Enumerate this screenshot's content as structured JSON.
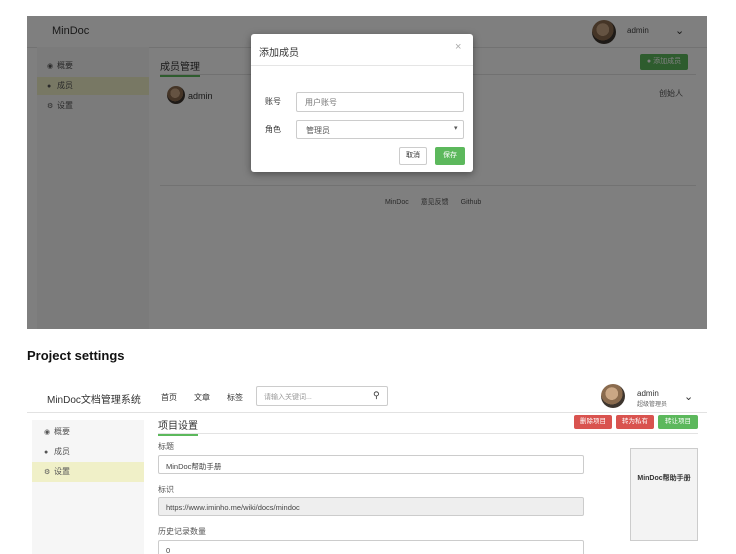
{
  "modal_screen": {
    "app_logo": "MinDoc",
    "user": {
      "name": "admin"
    },
    "sidebar": {
      "items": [
        {
          "icon": "dashboard-icon",
          "label": "概要"
        },
        {
          "icon": "users-icon",
          "label": "成员"
        },
        {
          "icon": "gear-icon",
          "label": "设置"
        }
      ]
    },
    "page_title": "成员管理",
    "add_member_button": "添加成员",
    "member": {
      "name": "admin",
      "role": "创始人"
    },
    "footer_links": [
      "MinDoc",
      "意见反馈",
      "Github"
    ],
    "dialog": {
      "title": "添加成员",
      "close": "×",
      "account_label": "账号",
      "account_placeholder": "用户账号",
      "role_label": "角色",
      "role_value": "管理员",
      "cancel_label": "取消",
      "save_label": "保存"
    }
  },
  "caption": "Project settings",
  "settings_screen": {
    "app_logo": "MinDoc文档管理系统",
    "nav": [
      "首页",
      "文章",
      "标签"
    ],
    "search_placeholder": "请输入关键词...",
    "user": {
      "name": "admin",
      "role": "超级管理员"
    },
    "sidebar": {
      "items": [
        {
          "icon": "dashboard-icon",
          "label": "概要"
        },
        {
          "icon": "users-icon",
          "label": "成员"
        },
        {
          "icon": "gear-icon",
          "label": "设置"
        }
      ]
    },
    "page_title": "项目设置",
    "buttons": {
      "delete": "删除项目",
      "private": "转为私有",
      "transfer": "转让项目"
    },
    "fields": {
      "title_label": "标题",
      "title_value": "MinDoc帮助手册",
      "identifier_label": "标识",
      "identifier_value": "https://www.iminho.me/wiki/docs/mindoc",
      "history_label": "历史记录数量",
      "history_value": "0"
    },
    "cover_text": "MinDoc帮助手册"
  },
  "colors": {
    "accent_green": "#5cb85c",
    "danger_red": "#d9534f",
    "sidebar_active": "#f0f0c8"
  }
}
